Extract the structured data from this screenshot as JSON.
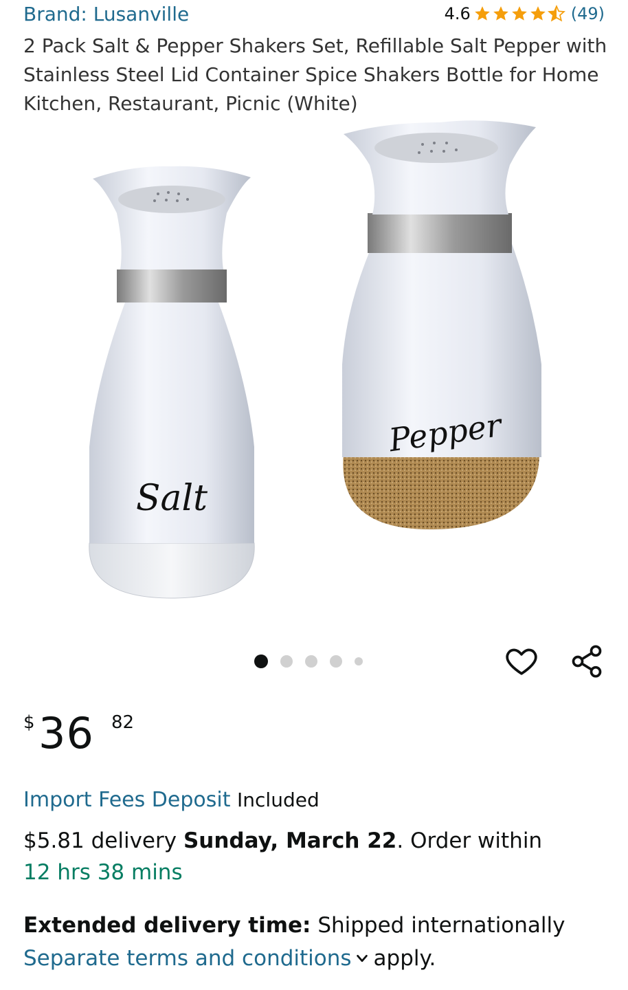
{
  "header": {
    "brand": "Brand: Lusanville",
    "rating_value": "4.6",
    "rating_stars": 4.6,
    "rating_count": "(49)"
  },
  "product": {
    "title": "2 Pack Salt & Pepper Shakers Set, Refillable Salt Pepper with Stainless Steel Lid Container Spice Shakers Bottle for Home Kitchen, Restaurant, Picnic (White)",
    "image_labels": {
      "left": "Salt",
      "right": "Pepper"
    }
  },
  "gallery": {
    "total_images": 5,
    "active_index": 0
  },
  "icons": {
    "favorite": "heart-icon",
    "share": "share-icon",
    "star": "star-icon",
    "dropdown": "chevron-down-icon"
  },
  "price": {
    "currency": "$",
    "whole": "36",
    "fraction": "82"
  },
  "import_fees": {
    "link": "Import Fees Deposit",
    "status": "Included"
  },
  "delivery": {
    "prefix": "$5.81 delivery",
    "date": "Sunday, March 22",
    "suffix": ". Order within",
    "countdown": "12 hrs 38 mins"
  },
  "extended": {
    "label": "Extended delivery time:",
    "text": "Shipped internationally",
    "link": "Separate terms and conditions",
    "tail": "apply."
  },
  "colors": {
    "link": "#1f6a8e",
    "star": "#f59e0b",
    "green": "#067d62"
  }
}
